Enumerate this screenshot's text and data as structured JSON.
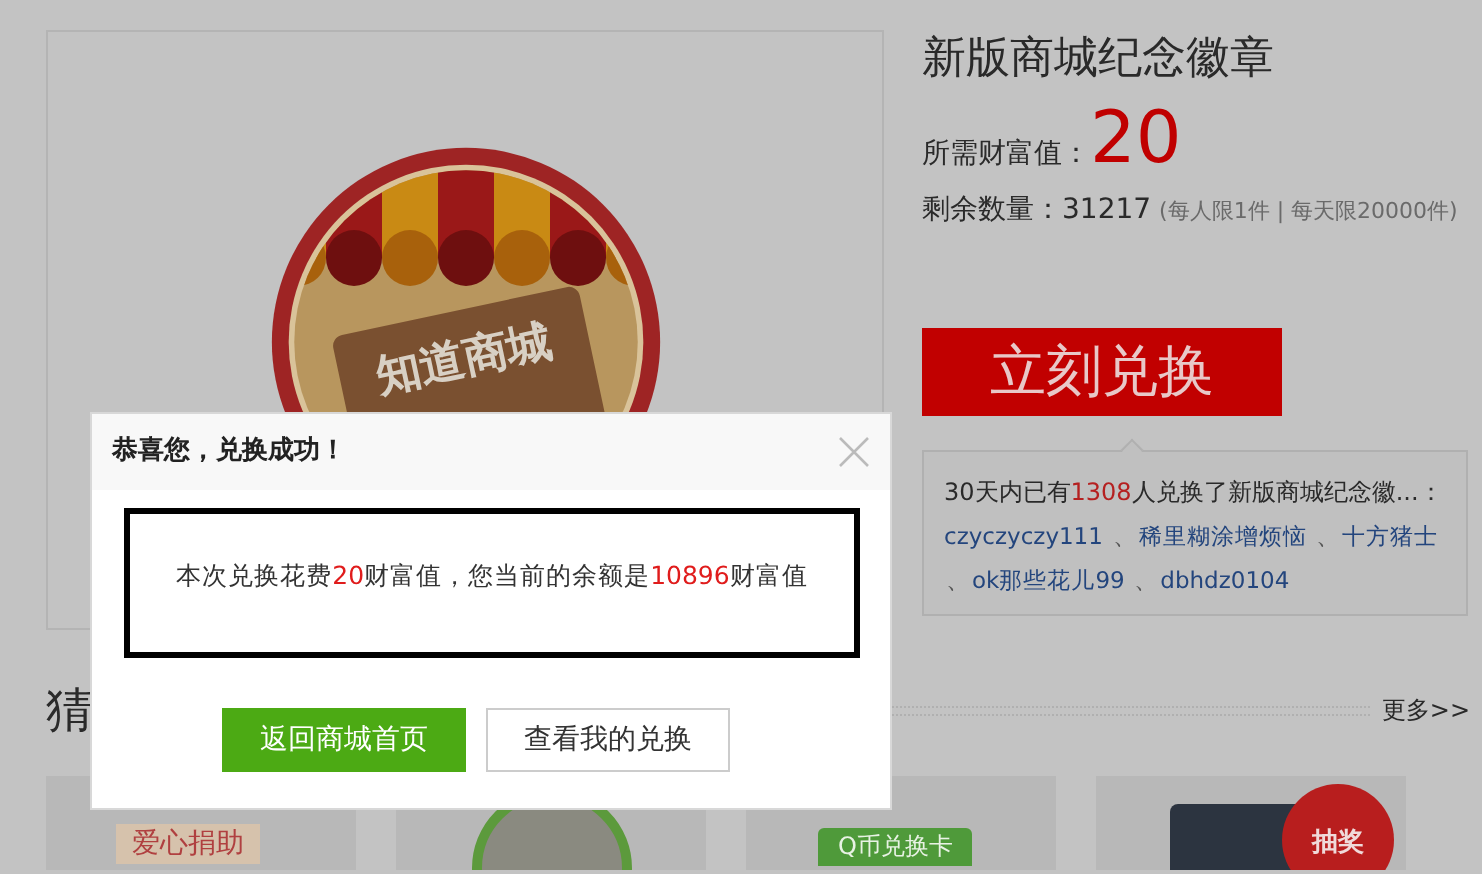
{
  "product": {
    "title": "新版商城纪念徽章",
    "price_label": "所需财富值：",
    "price": "20",
    "stock_label": "剩余数量：",
    "stock": "31217",
    "limit_note": "(每人限1件 | 每天限20000件)",
    "badge_text": "知道商城"
  },
  "redeem_button": "立刻兑换",
  "recent": {
    "prefix": "30天内已有",
    "count": "1308",
    "suffix": "人兑换了新版商城纪念徽...：",
    "separator": "、",
    "users": [
      "czyczyczy111",
      "稀里糊涂增烦恼",
      "十方猪士",
      "ok那些花儿99",
      "dbhdz0104"
    ]
  },
  "section": {
    "heading": "猜",
    "more_link": "更多>>"
  },
  "cards": [
    {
      "kind": "tag",
      "label": "爱心捐助"
    },
    {
      "kind": "avatar"
    },
    {
      "kind": "green_tag",
      "label": "Q币兑换卡"
    },
    {
      "kind": "tablet",
      "label": "抽奖"
    }
  ],
  "dialog": {
    "title": "恭喜您，兑换成功！",
    "message": [
      {
        "text": "本次兑换花费",
        "highlight": false
      },
      {
        "text": "20",
        "highlight": true
      },
      {
        "text": "财富值，您当前的余额是",
        "highlight": false
      },
      {
        "text": "10896",
        "highlight": true
      },
      {
        "text": "财富值",
        "highlight": false
      }
    ],
    "buttons": [
      {
        "label": "返回商城首页",
        "primary": true
      },
      {
        "label": "查看我的兑换",
        "primary": false
      }
    ]
  }
}
